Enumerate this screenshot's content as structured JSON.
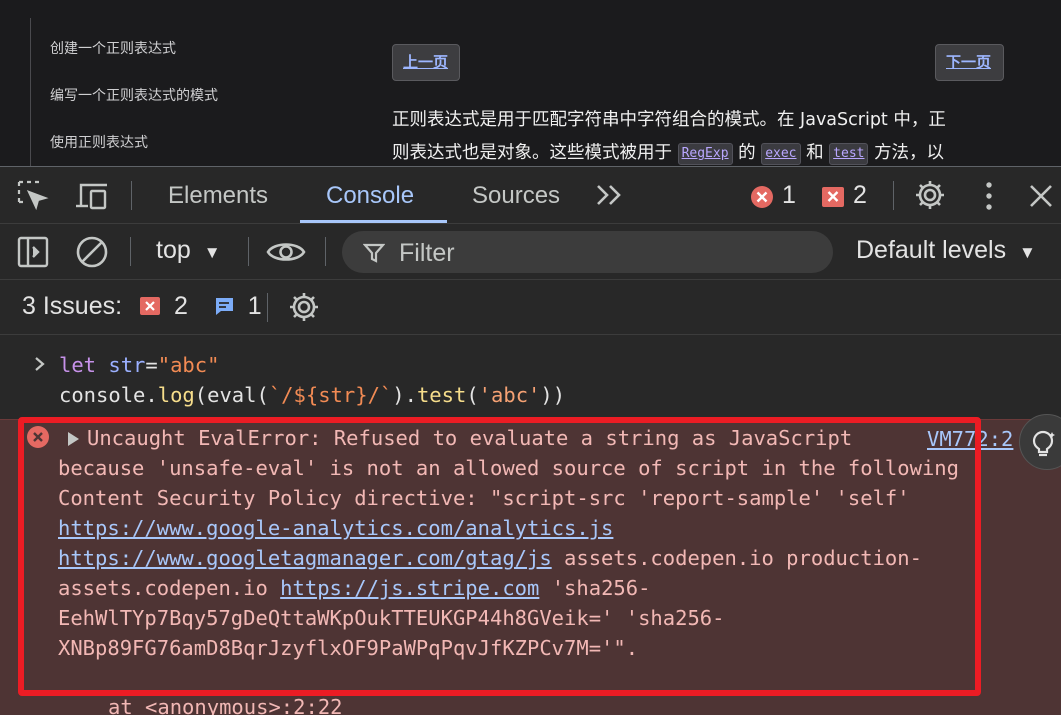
{
  "page": {
    "sidebar_items": [
      "创建一个正则表达式",
      "编写一个正则表达式的模式",
      "使用正则表达式"
    ],
    "prev_label": "上一页",
    "next_label": "下一页",
    "article": {
      "line1": "正则表达式是用于匹配字符串中字符组合的模式。在 JavaScript 中，正",
      "line2_a": "则表达式也是对象。这些模式被用于",
      "chip_regexp": "RegExp",
      "line2_b": "的",
      "chip_exec": "exec",
      "line2_c": "和",
      "chip_test": "test",
      "line2_d": "方法，以"
    }
  },
  "devtools": {
    "tabs": [
      "Elements",
      "Console",
      "Sources"
    ],
    "active_tab": "Console",
    "more_tabs_label": "»",
    "error_count": "1",
    "warning_count": "2",
    "context": "top",
    "filter_placeholder": "Filter",
    "levels_label": "Default levels",
    "issues_label": "3 Issues:",
    "issues_warning_count": "2",
    "issues_info_count": "1",
    "colors": {
      "accent": "#a8c7fa",
      "error": "#e46962",
      "error_bg": "#4e3434",
      "highlight": "#ec1c24"
    }
  },
  "console": {
    "input": {
      "line1": {
        "kw": "let",
        "var": " str",
        "eq": "=",
        "str": "\"abc\""
      },
      "line2": {
        "obj": "console.",
        "fn": "log",
        "p1": "(eval(",
        "tpl": "`/${str}/`",
        "p2": ").",
        "fn2": "test",
        "p3": "(",
        "str": "'abc'",
        "p4": "))"
      }
    },
    "error": {
      "source": "VM772:2",
      "line1": "Uncaught EvalError: Refused to evaluate a string as JavaScript",
      "line2": "because 'unsafe-eval' is not an allowed source of script in the following",
      "line3": "Content Security Policy directive: \"script-src 'report-sample' 'self'",
      "link1": "https://www.google-analytics.com/analytics.js",
      "link2": "https://www.googletagmanager.com/gtag/js",
      "line5_rest": " assets.codepen.io production-",
      "line6_pre": "assets.codepen.io ",
      "link3": "https://js.stripe.com",
      "line6_rest": " 'sha256-",
      "line7": "EehWlTYp7Bqy57gDeQttaWKpOukTTEUKGP44h8GVeik=' 'sha256-",
      "line8": "XNBp89FG76amD8BqrJzyflxOF9PaWPqPqvJfKZPCv7M='\".",
      "stack": "at <anonymous>:2:22"
    }
  }
}
